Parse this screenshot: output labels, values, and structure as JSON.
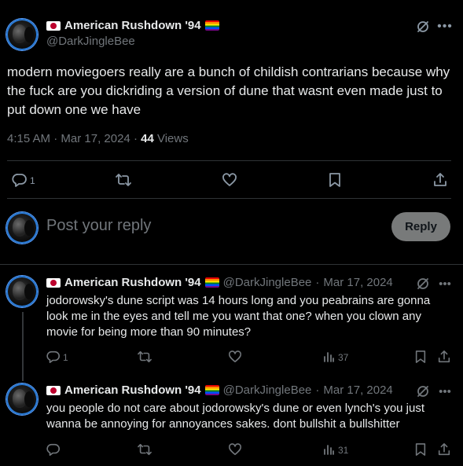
{
  "main_tweet": {
    "display_name": "American Rushdown '94",
    "handle": "@DarkJingleBee",
    "text": "modern moviegoers really are a bunch of childish contrarians because why the fuck are you dickriding a version of dune that wasnt even made just to put down one we have",
    "time": "4:15 AM",
    "date": "Mar 17, 2024",
    "views_count": "44",
    "views_label": "Views",
    "reply_count": "1"
  },
  "composer": {
    "placeholder": "Post your reply",
    "button_label": "Reply"
  },
  "replies": [
    {
      "display_name": "American Rushdown '94",
      "handle": "@DarkJingleBee",
      "date": "Mar 17, 2024",
      "text": "jodorowsky's dune script was 14 hours long and you peabrains are gonna look me in the eyes and tell me you want that one? when you clown any movie for being more than 90 minutes?",
      "reply_count": "1",
      "views": "37"
    },
    {
      "display_name": "American Rushdown '94",
      "handle": "@DarkJingleBee",
      "date": "Mar 17, 2024",
      "text": "you people do not care about jodorowsky's dune or even lynch's you just wanna be annoying for annoyances sakes. dont bullshit a bullshitter",
      "reply_count": "",
      "views": "31"
    }
  ],
  "icons": [
    "japan-flag",
    "pride-flag",
    "grok-icon",
    "more-icon",
    "reply-icon",
    "retweet-icon",
    "like-icon",
    "bookmark-icon",
    "share-icon",
    "analytics-icon"
  ],
  "colors": {
    "background": "#000000",
    "text": "#e7e9ea",
    "muted": "#71767b",
    "divider": "#2f3336",
    "reply_button": "#787a7a"
  }
}
